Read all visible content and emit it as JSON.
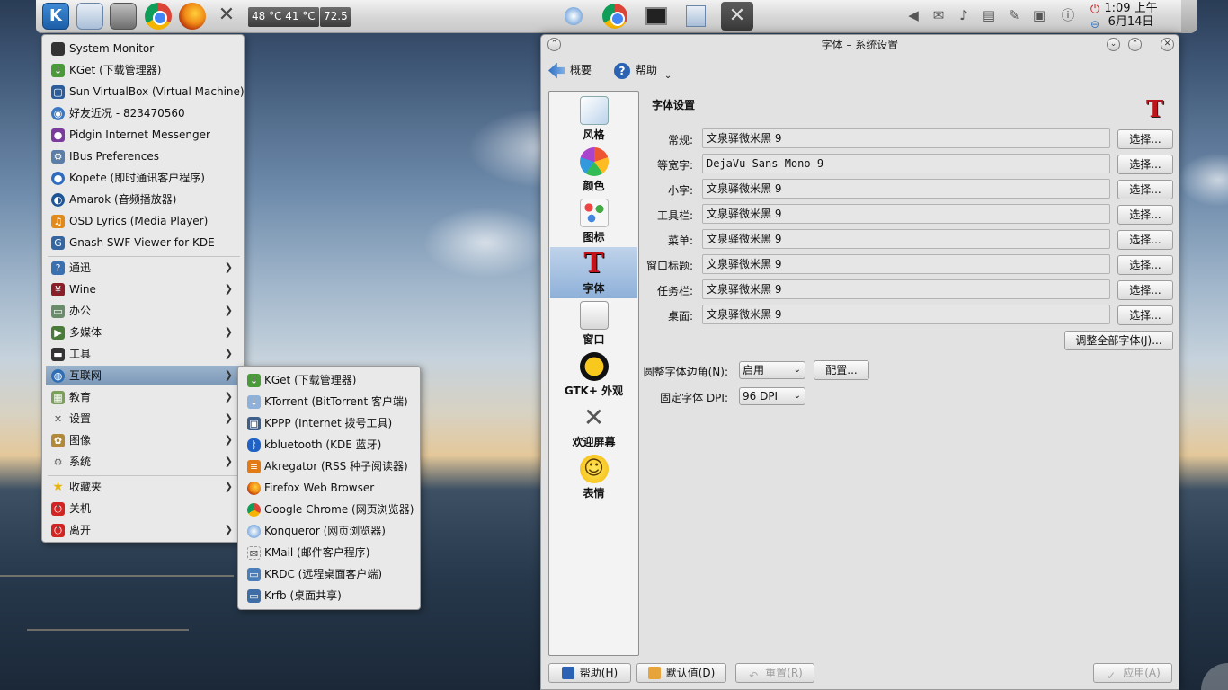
{
  "panel": {
    "temps": "48 °C  41 °C",
    "temp2": "72.5",
    "clock_time": "1:09 上午",
    "clock_date": "6月14日"
  },
  "menu": {
    "apps": [
      {
        "label": "System Monitor",
        "icon": "monitor-icon"
      },
      {
        "label": "KGet (下载管理器)",
        "icon": "download-icon"
      },
      {
        "label": "Sun VirtualBox (Virtual Machine)",
        "icon": "virtualbox-icon"
      },
      {
        "label": "好友近况 - 823470560",
        "icon": "contacts-icon"
      },
      {
        "label": "Pidgin Internet Messenger",
        "icon": "pidgin-icon"
      },
      {
        "label": "IBus Preferences",
        "icon": "ibus-icon"
      },
      {
        "label": "Kopete (即时通讯客户程序)",
        "icon": "kopete-icon"
      },
      {
        "label": "Amarok (音频播放器)",
        "icon": "amarok-icon"
      },
      {
        "label": "OSD Lyrics (Media Player)",
        "icon": "lyrics-icon"
      },
      {
        "label": "Gnash SWF Viewer for KDE",
        "icon": "gnash-icon"
      }
    ],
    "categories": [
      {
        "label": "通迅",
        "icon": "help-icon"
      },
      {
        "label": "Wine",
        "icon": "wine-icon"
      },
      {
        "label": "办公",
        "icon": "office-icon"
      },
      {
        "label": "多媒体",
        "icon": "multimedia-icon"
      },
      {
        "label": "工具",
        "icon": "tools-icon"
      },
      {
        "label": "互联网",
        "icon": "internet-icon"
      },
      {
        "label": "教育",
        "icon": "education-icon"
      },
      {
        "label": "设置",
        "icon": "settings-icon"
      },
      {
        "label": "图像",
        "icon": "graphics-icon"
      },
      {
        "label": "系统",
        "icon": "system-icon"
      }
    ],
    "footer": [
      {
        "label": "收藏夹",
        "icon": "star-icon"
      },
      {
        "label": "关机",
        "icon": "power-icon"
      },
      {
        "label": "离开",
        "icon": "logout-icon"
      }
    ]
  },
  "submenu": {
    "items": [
      {
        "label": "KGet (下载管理器)",
        "icon": "download-icon"
      },
      {
        "label": "KTorrent (BitTorrent 客户端)",
        "icon": "torrent-icon"
      },
      {
        "label": "KPPP (Internet 拨号工具)",
        "icon": "dialup-icon"
      },
      {
        "label": "kbluetooth (KDE 蓝牙)",
        "icon": "bluetooth-icon"
      },
      {
        "label": "Akregator (RSS 种子阅读器)",
        "icon": "rss-icon"
      },
      {
        "label": "Firefox Web Browser",
        "icon": "firefox-icon"
      },
      {
        "label": "Google Chrome (网页浏览器)",
        "icon": "chrome-icon"
      },
      {
        "label": "Konqueror (网页浏览器)",
        "icon": "konqueror-icon"
      },
      {
        "label": "KMail (邮件客户程序)",
        "icon": "mail-icon"
      },
      {
        "label": "KRDC (远程桌面客户端)",
        "icon": "remote-desktop-icon"
      },
      {
        "label": "Krfb (桌面共享)",
        "icon": "desktop-share-icon"
      }
    ]
  },
  "window": {
    "title": "字体 – 系统设置",
    "overview": "概要",
    "help": "帮助",
    "sidebar": [
      {
        "label": "风格",
        "icon": "style-icon"
      },
      {
        "label": "颜色",
        "icon": "colors-icon"
      },
      {
        "label": "图标",
        "icon": "icons-icon"
      },
      {
        "label": "字体",
        "icon": "fonts-icon"
      },
      {
        "label": "窗口",
        "icon": "windows-icon"
      },
      {
        "label": "GTK+ 外观",
        "icon": "gtk-icon"
      },
      {
        "label": "欢迎屏幕",
        "icon": "splash-icon"
      },
      {
        "label": "表情",
        "icon": "emoticons-icon"
      }
    ],
    "heading": "字体设置",
    "fonts": [
      {
        "label": "常规:",
        "value": "文泉驿微米黑 9"
      },
      {
        "label": "等宽字:",
        "value": "DejaVu Sans Mono 9"
      },
      {
        "label": "小字:",
        "value": "文泉驿微米黑 9"
      },
      {
        "label": "工具栏:",
        "value": "文泉驿微米黑 9"
      },
      {
        "label": "菜单:",
        "value": "文泉驿微米黑 9"
      },
      {
        "label": "窗口标题:",
        "value": "文泉驿微米黑 9"
      },
      {
        "label": "任务栏:",
        "value": "文泉驿微米黑 9"
      },
      {
        "label": "桌面:",
        "value": "文泉驿微米黑 9"
      }
    ],
    "choose": "选择...",
    "adjust_all": "调整全部字体(J)...",
    "antialias_label": "圆整字体边角(N):",
    "antialias_value": "启用",
    "configure": "配置...",
    "dpi_label": "固定字体 DPI:",
    "dpi_value": "96 DPI",
    "btn_help": "帮助(H)",
    "btn_defaults": "默认值(D)",
    "btn_reset": "重置(R)",
    "btn_apply": "应用(A)"
  }
}
